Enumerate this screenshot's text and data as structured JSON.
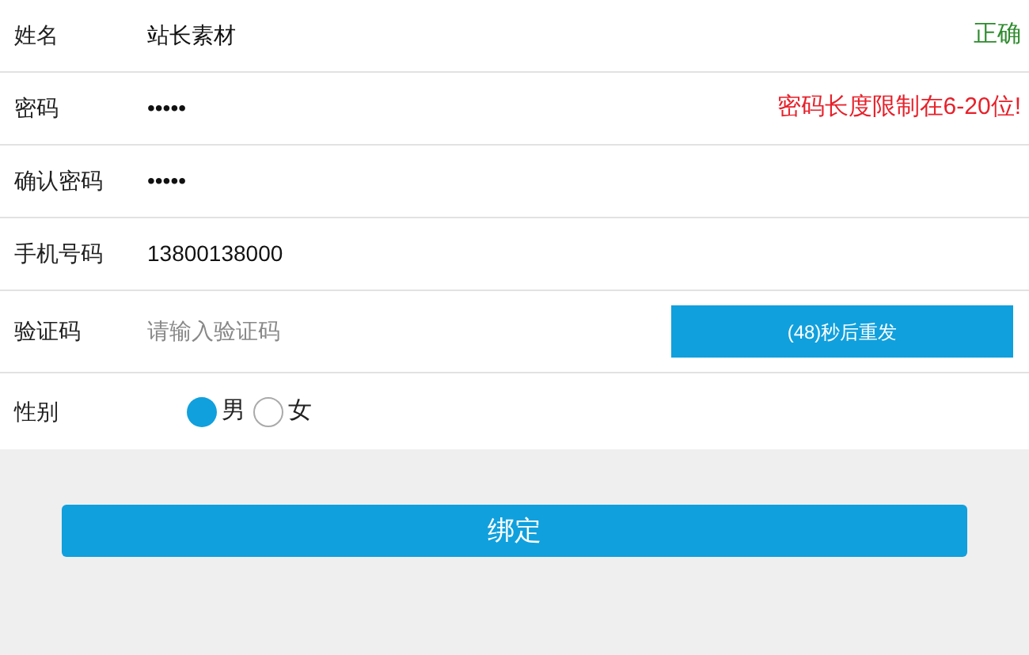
{
  "fields": [
    {
      "kind": "text",
      "label": "姓名",
      "value": "站长素材",
      "message": "正确",
      "color": "#2e8b2e"
    },
    {
      "kind": "text",
      "label": "密码",
      "value": "•••••",
      "message": "密码长度限制在6-20位!",
      "color": "#e8202a"
    },
    {
      "kind": "text",
      "label": "确认密码",
      "value": "•••••"
    },
    {
      "kind": "text",
      "label": "手机号码",
      "value": "13800138000"
    },
    {
      "kind": "code",
      "label": "验证码",
      "placeholder": "请输入验证码",
      "button": "(48)秒后重发"
    },
    {
      "kind": "radio",
      "label": "性别",
      "options": [
        {
          "label": "男",
          "selected": true
        },
        {
          "label": "女",
          "selected": false
        }
      ]
    }
  ],
  "submit": "绑定"
}
